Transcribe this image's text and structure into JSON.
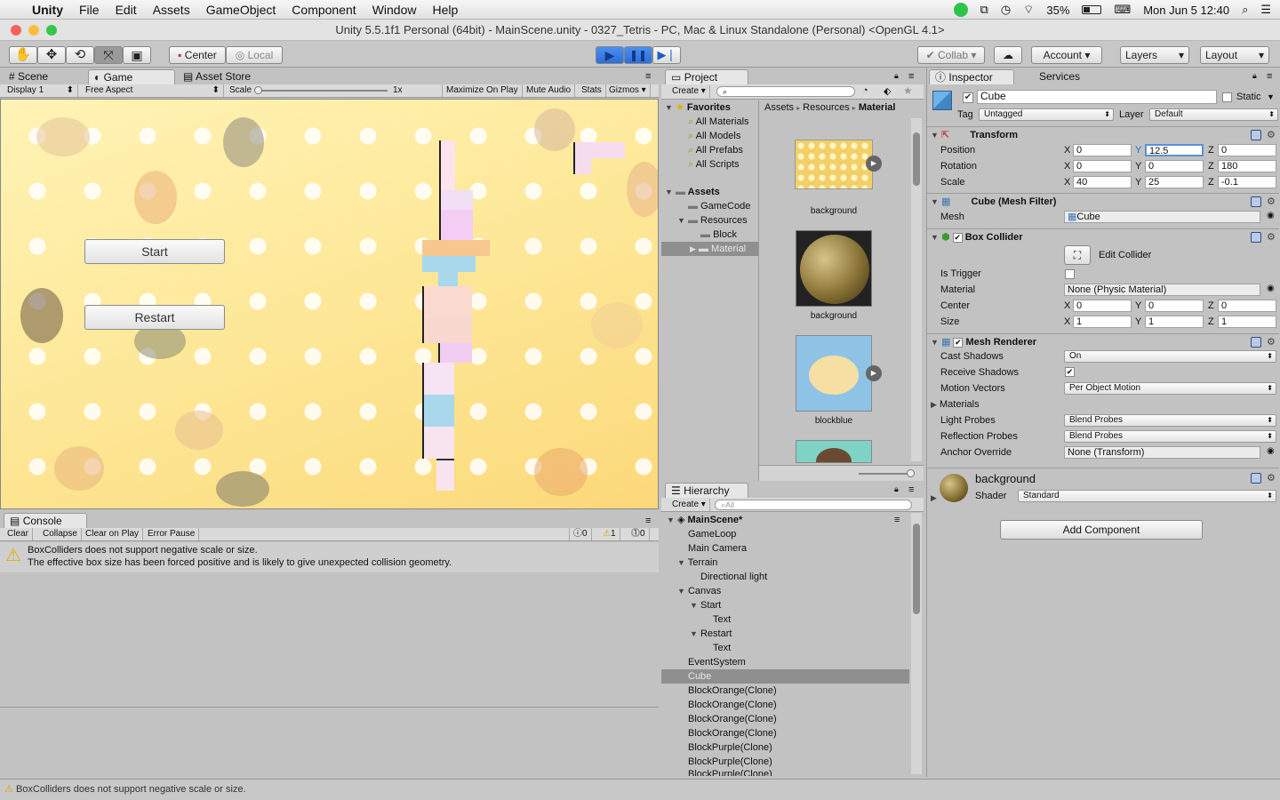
{
  "menubar": {
    "app": "Unity",
    "items": [
      "File",
      "Edit",
      "Assets",
      "GameObject",
      "Component",
      "Window",
      "Help"
    ],
    "battery": "35%",
    "datetime": "Mon Jun 5  12:40"
  },
  "window": {
    "title": "Unity 5.5.1f1 Personal (64bit) - MainScene.unity - 0327_Tetris - PC, Mac & Linux Standalone (Personal) <OpenGL 4.1>"
  },
  "toolbar": {
    "pivot": "Center",
    "space": "Local",
    "collab": "Collab",
    "account": "Account",
    "layers": "Layers",
    "layout": "Layout"
  },
  "scene_tabs": {
    "scene": "Scene",
    "game": "Game",
    "asset_store": "Asset Store",
    "display": "Display 1",
    "aspect": "Free Aspect",
    "scale_label": "Scale",
    "scale_value": "1x",
    "maximize": "Maximize On Play",
    "mute": "Mute Audio",
    "stats": "Stats",
    "gizmos": "Gizmos"
  },
  "game": {
    "start_button": "Start",
    "restart_button": "Restart"
  },
  "project": {
    "tab": "Project",
    "create": "Create",
    "favorites": "Favorites",
    "fav_items": [
      "All Materials",
      "All Models",
      "All Prefabs",
      "All Scripts"
    ],
    "assets": "Assets",
    "folders": {
      "gamecode": "GameCode",
      "resources": "Resources",
      "block": "Block",
      "material": "Material"
    },
    "breadcrumb": [
      "Assets",
      "Resources",
      "Material"
    ],
    "thumbs": [
      "background",
      "background",
      "blockblue"
    ]
  },
  "hierarchy": {
    "tab": "Hierarchy",
    "create": "Create",
    "search_placeholder": "All",
    "scene": "MainScene*",
    "items": {
      "gameloop": "GameLoop",
      "camera": "Main Camera",
      "terrain": "Terrain",
      "light": "Directional light",
      "canvas": "Canvas",
      "start": "Start",
      "start_text": "Text",
      "restart": "Restart",
      "restart_text": "Text",
      "eventsystem": "EventSystem",
      "cube": "Cube",
      "bo1": "BlockOrange(Clone)",
      "bo2": "BlockOrange(Clone)",
      "bo3": "BlockOrange(Clone)",
      "bo4": "BlockOrange(Clone)",
      "bp1": "BlockPurple(Clone)",
      "bp2": "BlockPurple(Clone)",
      "bp3": "BlockPurple(Clone)"
    }
  },
  "inspector": {
    "tab": "Inspector",
    "services": "Services",
    "object_name": "Cube",
    "static": "Static",
    "tag_label": "Tag",
    "tag": "Untagged",
    "layer_label": "Layer",
    "layer": "Default",
    "transform": {
      "title": "Transform",
      "position": "Position",
      "px": "0",
      "py": "12.5",
      "pz": "0",
      "rotation": "Rotation",
      "rx": "0",
      "ry": "0",
      "rz": "180",
      "scale": "Scale",
      "sx": "40",
      "sy": "25",
      "sz": "-0.1"
    },
    "mesh_filter": {
      "title": "Cube (Mesh Filter)",
      "mesh_label": "Mesh",
      "mesh": "Cube"
    },
    "box_collider": {
      "title": "Box Collider",
      "edit": "Edit Collider",
      "is_trigger": "Is Trigger",
      "material_label": "Material",
      "material": "None (Physic Material)",
      "center": "Center",
      "cx": "0",
      "cy": "0",
      "cz": "0",
      "size": "Size",
      "szx": "1",
      "szy": "1",
      "szz": "1"
    },
    "mesh_renderer": {
      "title": "Mesh Renderer",
      "cast_shadows": "Cast Shadows",
      "cast_value": "On",
      "receive_shadows": "Receive Shadows",
      "motion_vectors": "Motion Vectors",
      "motion_value": "Per Object Motion",
      "materials": "Materials",
      "light_probes": "Light Probes",
      "light_value": "Blend Probes",
      "reflection_probes": "Reflection Probes",
      "reflection_value": "Blend Probes",
      "anchor_override": "Anchor Override",
      "anchor_value": "None (Transform)"
    },
    "material": {
      "name": "background",
      "shader_label": "Shader",
      "shader": "Standard"
    },
    "add_component": "Add Component"
  },
  "console": {
    "tab": "Console",
    "clear": "Clear",
    "collapse": "Collapse",
    "clear_on_play": "Clear on Play",
    "error_pause": "Error Pause",
    "count_info": "0",
    "count_warn": "1",
    "count_error": "0",
    "message_line1": "BoxColliders does not support negative scale or size.",
    "message_line2": "The effective box size has been forced positive and is likely to give unexpected collision geometry."
  },
  "statusbar": {
    "message": "BoxColliders does not support negative scale or size."
  }
}
